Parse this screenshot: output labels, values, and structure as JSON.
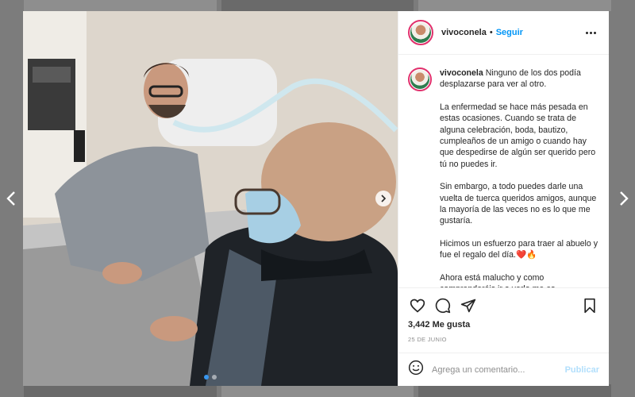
{
  "post": {
    "username": "vivoconela",
    "separator": "•",
    "follow_label": "Seguir",
    "caption_paragraphs": [
      "Ninguno de los dos podía desplazarse para ver al otro.",
      "La enfermedad se hace más pesada en estas ocasiones. Cuando se trata de alguna celebración, boda, bautizo, cumpleaños de un amigo o cuando hay que despedirse de algún ser querido pero tú no puedes ir.",
      "Sin embargo, a todo puedes darle una vuelta de tuerca queridos amigos, aunque la mayoría de las veces no es lo que me gustaría.",
      "Hicimos un esfuerzo para traer al abuelo y fue el regalo del día.❤️🔥",
      "Ahora está malucho y como comprenderéis ir a verlo me es"
    ],
    "likes": "3,442 Me gusta",
    "date": "25 DE JUNIO",
    "comment_placeholder": "Agrega un comentario...",
    "publish_label": "Publicar"
  },
  "icons": {
    "heart": "heart-icon",
    "comment": "comment-icon",
    "share": "share-icon",
    "save": "bookmark-icon",
    "emoji": "emoji-icon",
    "more": "more-options-icon",
    "prev": "chevron-left-icon",
    "next": "chevron-right-icon"
  },
  "colors": {
    "accent": "#0095f6",
    "publish_disabled": "#b2dffc",
    "overlay": "#7c7c7c"
  }
}
